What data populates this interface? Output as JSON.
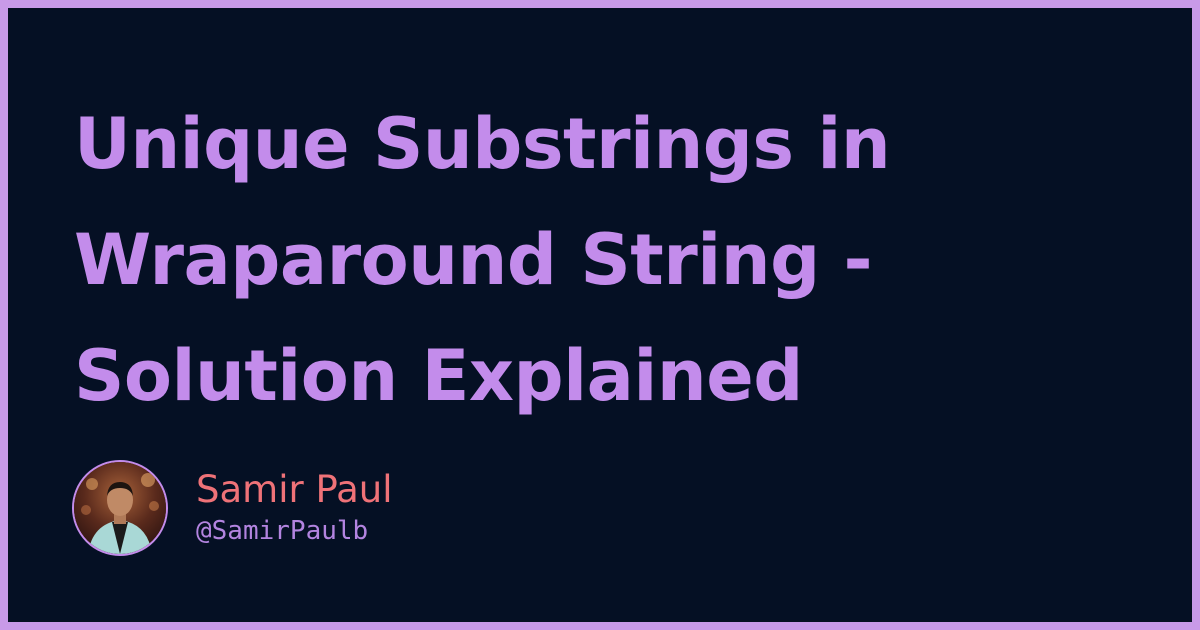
{
  "title": {
    "lines": [
      "Unique Substrings in",
      "Wraparound String -",
      "Solution Explained"
    ]
  },
  "author": {
    "name": "Samir Paul",
    "handle": "@SamirPaulb",
    "avatar_icon": "person-photo"
  },
  "colors": {
    "frame": "#c89ae8",
    "background": "#051024",
    "title": "#c38ceb",
    "author_name": "#ef7278",
    "author_handle": "#b384e0"
  }
}
